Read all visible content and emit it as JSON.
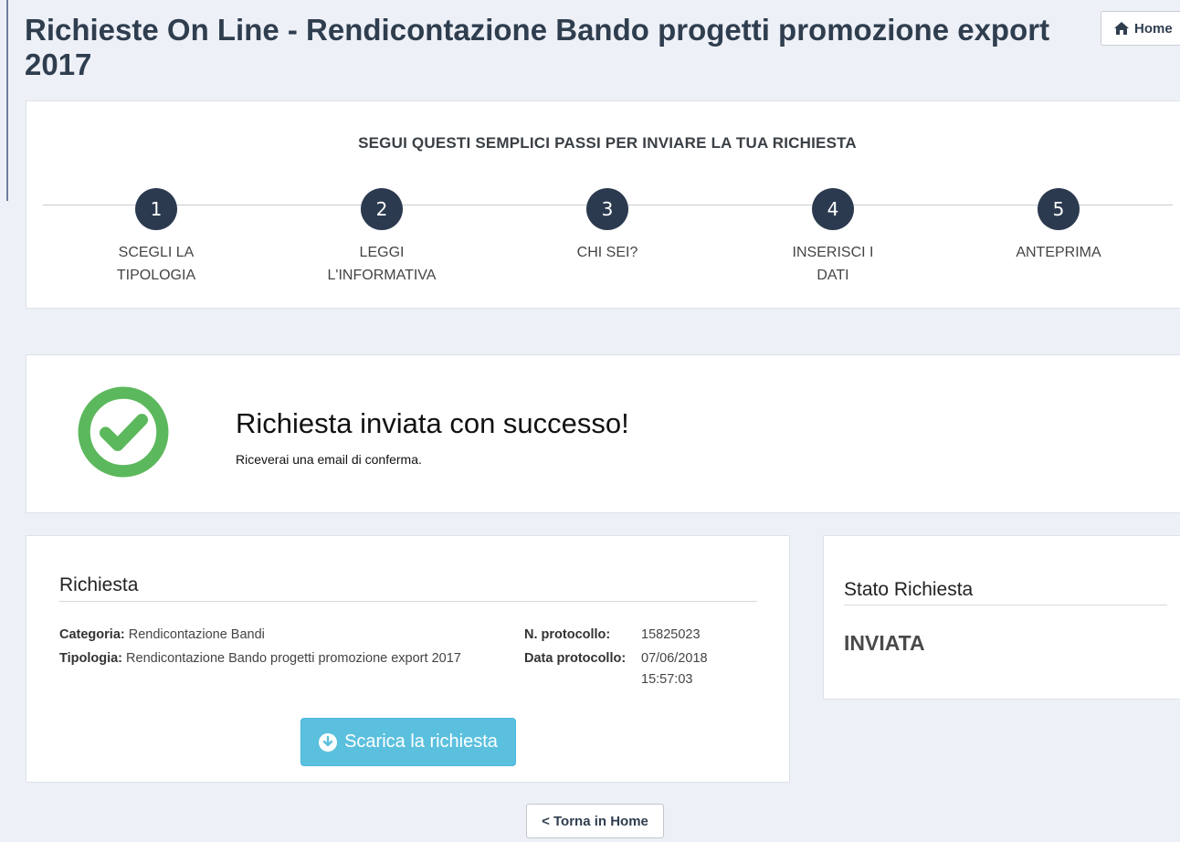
{
  "header": {
    "title": "Richieste On Line - Rendicontazione Bando progetti promozione export 2017",
    "home_label": "Home"
  },
  "steps": {
    "heading": "SEGUI QUESTI SEMPLICI PASSI PER INVIARE LA TUA RICHIESTA",
    "items": [
      {
        "number": "1",
        "label": "SCEGLI LA TIPOLOGIA"
      },
      {
        "number": "2",
        "label": "LEGGI L'INFORMATIVA"
      },
      {
        "number": "3",
        "label": "CHI SEI?"
      },
      {
        "number": "4",
        "label": "INSERISCI I DATI"
      },
      {
        "number": "5",
        "label": "ANTEPRIMA"
      }
    ]
  },
  "success": {
    "title": "Richiesta inviata con successo!",
    "subtitle": "Riceverai una email di conferma.",
    "color": "#5cb85c"
  },
  "request": {
    "title": "Richiesta",
    "category_label": "Categoria:",
    "category_value": "Rendicontazione Bandi",
    "type_label": "Tipologia:",
    "type_value": "Rendicontazione Bando progetti promozione export 2017",
    "protocol_number_label": "N. protocollo:",
    "protocol_number_value": "15825023",
    "protocol_date_label": "Data protocollo:",
    "protocol_date_value": "07/06/2018",
    "protocol_time_value": "15:57:03",
    "download_label": "Scarica la richiesta"
  },
  "status": {
    "title": "Stato Richiesta",
    "value": "INVIATA"
  },
  "footer": {
    "back_label": "< Torna in Home"
  }
}
